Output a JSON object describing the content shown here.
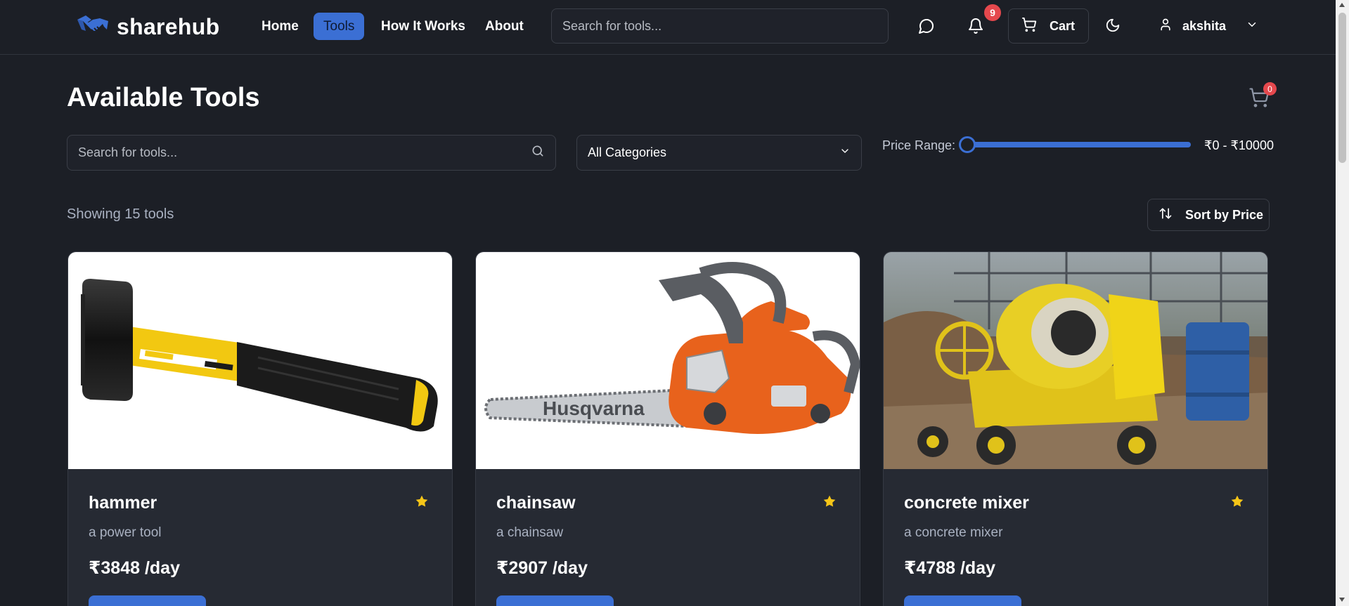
{
  "brand": {
    "name": "sharehub",
    "icon": "handshake-icon"
  },
  "nav": {
    "links": [
      {
        "label": "Home",
        "active": false
      },
      {
        "label": "Tools",
        "active": true
      },
      {
        "label": "How It Works",
        "active": false
      },
      {
        "label": "About",
        "active": false
      }
    ],
    "search_placeholder": "Search for tools...",
    "notifications_count": "9",
    "cart_label": "Cart",
    "username": "akshita"
  },
  "page": {
    "title": "Available Tools",
    "cart_count": "0",
    "search_placeholder": "Search for tools...",
    "category_selected": "All Categories",
    "price_range_label": "Price Range:",
    "price_range_value": "₹0 - ₹10000",
    "price_range_min_fraction": 0,
    "showing_text": "Showing 15 tools",
    "sort_label": "Sort by Price"
  },
  "tools": [
    {
      "name": "hammer",
      "description": "a power tool",
      "price": "₹3848 /day",
      "image": "sledgehammer-photo"
    },
    {
      "name": "chainsaw",
      "description": "a chainsaw",
      "price": "₹2907 /day",
      "image": "chainsaw-photo"
    },
    {
      "name": "concrete mixer",
      "description": "a concrete mixer",
      "price": "₹4788 /day",
      "image": "concrete-mixer-photo"
    }
  ],
  "colors": {
    "background": "#1c1f26",
    "card": "#262a33",
    "accent": "#3b6fd4",
    "badge": "#e5484d",
    "star": "#f5c518"
  }
}
